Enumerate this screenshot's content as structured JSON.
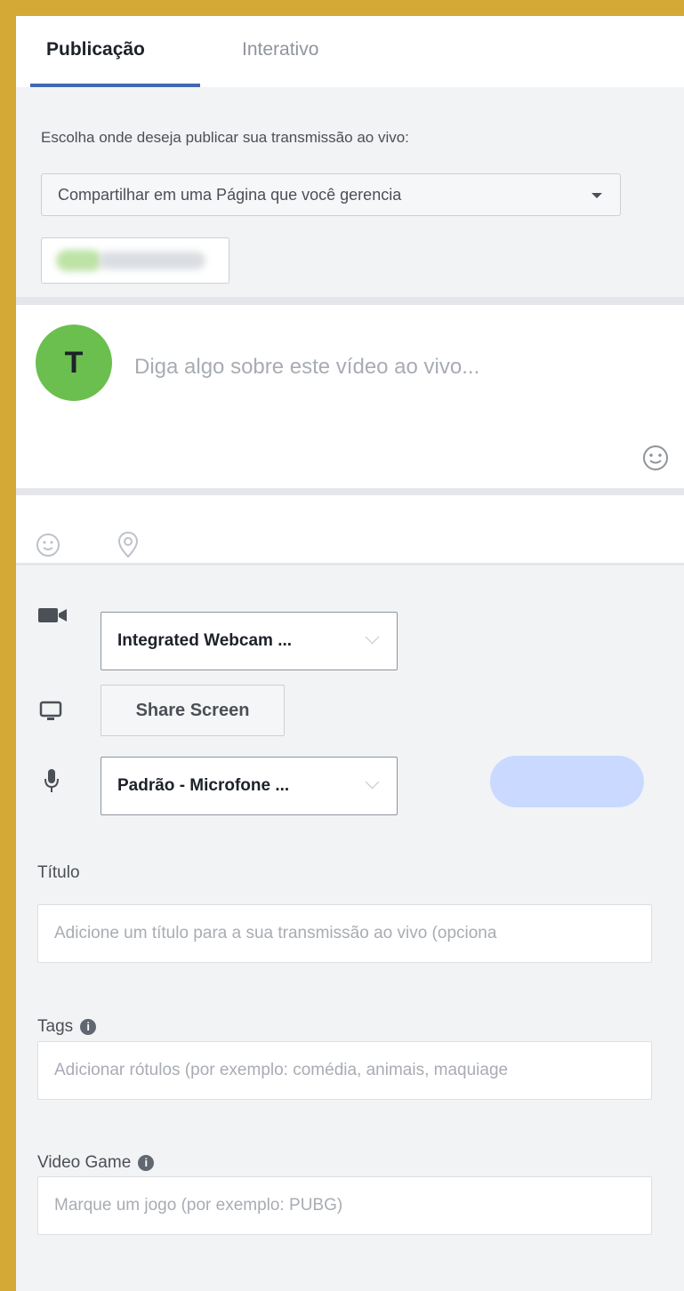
{
  "tabs": [
    {
      "label": "Publicação",
      "active": true
    },
    {
      "label": "Interativo",
      "active": false
    }
  ],
  "publish": {
    "prompt": "Escolha onde deseja publicar sua transmissão ao vivo:",
    "destination": "Compartilhar em uma Página que você gerencia"
  },
  "composer": {
    "avatar_initial": "T",
    "placeholder": "Diga algo sobre este vídeo ao vivo..."
  },
  "devices": {
    "camera": "Integrated Webcam ...",
    "share_screen": "Share Screen",
    "microphone": "Padrão - Microfone ..."
  },
  "fields": {
    "title_label": "Título",
    "title_placeholder": "Adicione um título para a sua transmissão ao vivo (opciona",
    "tags_label": "Tags",
    "tags_placeholder": "Adicionar rótulos (por exemplo: comédia, animais, maquiage",
    "game_label": "Video Game",
    "game_placeholder": "Marque um jogo (por exemplo: PUBG)"
  },
  "colors": {
    "frame": "#d4a935",
    "accent": "#4267b2",
    "avatar": "#6bbf4e"
  }
}
